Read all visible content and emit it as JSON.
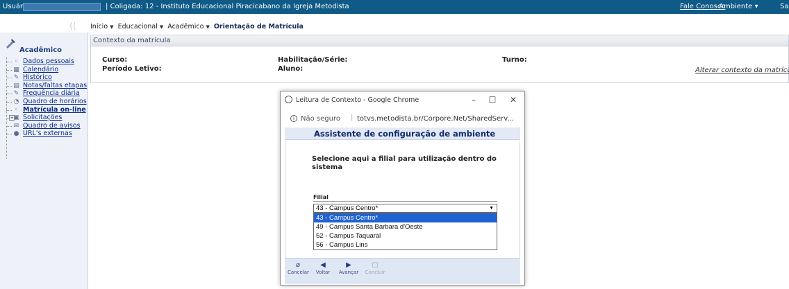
{
  "topbar": {
    "user_label": "Usuário:",
    "coligada": "| Coligada: 12 - Instituto Educacional Piracicabano da Igreja Metodista",
    "fale_conosco": "Fale Conosco",
    "ambiente": "Ambiente ▾",
    "sair": "Sa"
  },
  "breadcrumb": {
    "items": [
      "Início",
      "Educacional",
      "Acadêmico",
      "Orientação de Matrícula"
    ]
  },
  "sidebar": {
    "title": "Acadêmico",
    "items": [
      {
        "label": "Dados pessoais",
        "icon": "person-icon",
        "glyph": "◦"
      },
      {
        "label": "Calendário",
        "icon": "calendar-icon",
        "glyph": "▦"
      },
      {
        "label": "Histórico",
        "icon": "history-icon",
        "glyph": "✎"
      },
      {
        "label": "Notas/faltas etapas",
        "icon": "grades-icon",
        "glyph": "▤"
      },
      {
        "label": "Frequência diária",
        "icon": "attendance-icon",
        "glyph": "✎"
      },
      {
        "label": "Quadro de horários",
        "icon": "clock-icon",
        "glyph": "◔"
      },
      {
        "label": "Matrícula on-line",
        "icon": "enroll-icon",
        "glyph": "◦"
      },
      {
        "label": "Solicitações",
        "icon": "requests-icon",
        "glyph": "▣"
      },
      {
        "label": "Quadro de avisos",
        "icon": "notices-icon",
        "glyph": "✉"
      },
      {
        "label": "URL's externas",
        "icon": "globe-icon",
        "glyph": "●"
      }
    ]
  },
  "context": {
    "header": "Contexto da matrícula",
    "curso": "Curso:",
    "periodo": "Período Letivo:",
    "habilitacao": "Habilitação/Série:",
    "aluno": "Aluno:",
    "turno": "Turno:",
    "alterar": "Alterar contexto da matrícula"
  },
  "popup": {
    "title": "Leitura de Contexto - Google Chrome",
    "insecure": "Não seguro",
    "url": "totvs.metodista.br/Corpore.Net/SharedServ...",
    "banner": "Assistente de configuração de ambiente",
    "instruction": "Selecione aqui a filial para utilização dentro do sistema",
    "filial_label": "Filial",
    "selected_value": "43 - Campus Centro*",
    "options": [
      "43 - Campus Centro*",
      "49 - Campus Santa Barbara d'Oeste",
      "52 - Campus Taquaral",
      "56 - Campus Lins"
    ],
    "buttons": {
      "cancelar": "Cancelar",
      "voltar": "Voltar",
      "avancar": "Avançar",
      "concluir": "Concluir"
    }
  }
}
